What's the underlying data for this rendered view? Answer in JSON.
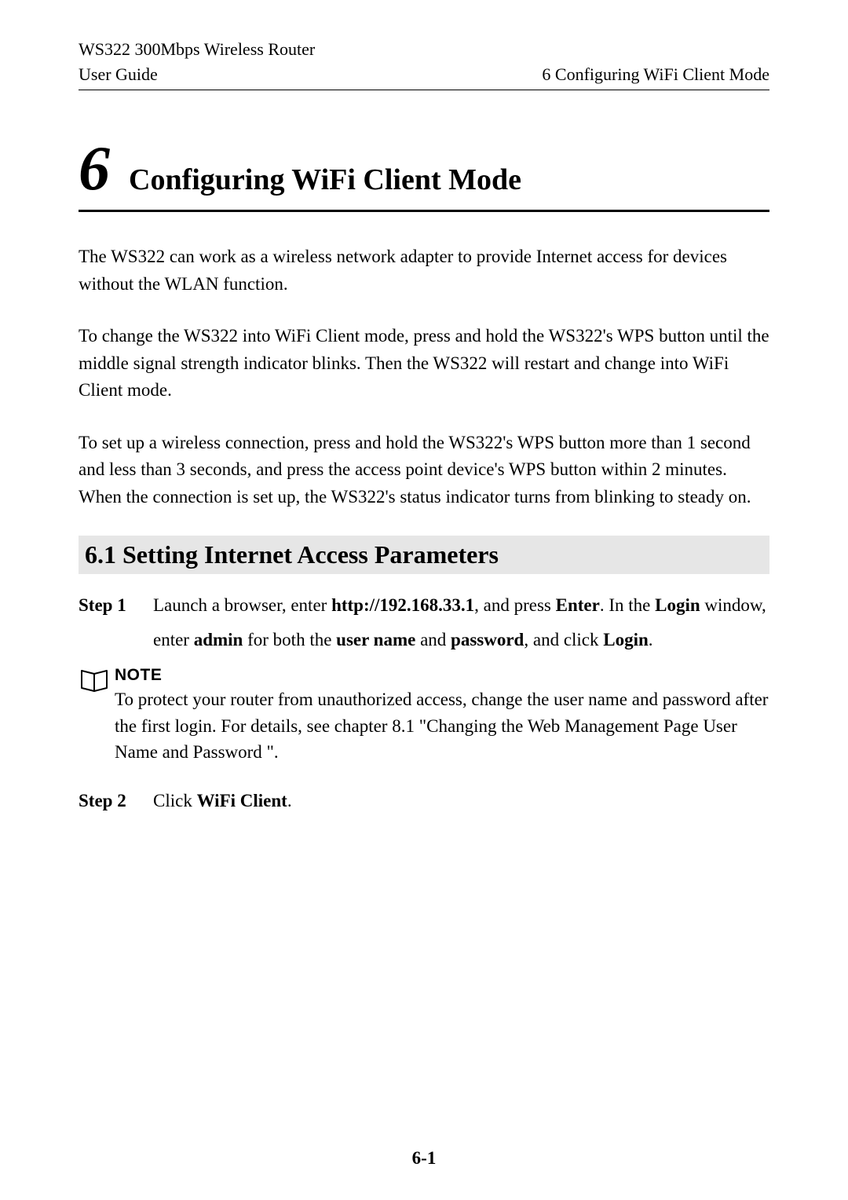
{
  "header": {
    "product": "WS322 300Mbps Wireless Router",
    "left": "User Guide",
    "right": "6 Configuring WiFi Client Mode"
  },
  "chapter": {
    "number": "6",
    "title": "Configuring WiFi Client Mode"
  },
  "paragraphs": {
    "p1": "The WS322 can work as a wireless network adapter to provide Internet access for devices without the WLAN function.",
    "p2": "To change the WS322 into WiFi Client mode, press and hold the WS322's WPS button until the middle signal strength indicator blinks. Then the WS322 will restart and change into WiFi Client mode.",
    "p3": "To set up a wireless connection, press and hold the WS322's WPS button more than 1 second and less than 3 seconds, and press the access point device's WPS button within 2 minutes. When the connection is set up, the WS322's status indicator turns from blinking to steady on."
  },
  "section_6_1": {
    "heading": "6.1 Setting Internet Access Parameters"
  },
  "step1": {
    "label": "Step 1",
    "seg1": "Launch a browser, enter ",
    "url": "http://192.168.33.1",
    "seg2": ", and press ",
    "enter": "Enter",
    "seg3": ". In the ",
    "login1": "Login",
    "seg4": " window, enter ",
    "admin": "admin",
    "seg5": " for both the ",
    "username": "user name",
    "seg6": " and ",
    "password": "password",
    "seg7": ", and click ",
    "login2": "Login",
    "seg8": "."
  },
  "note": {
    "label": "NOTE",
    "text": "To protect your router from unauthorized access, change the user name and password after the first login. For details, see chapter 8.1  \"Changing the Web Management Page User Name and Password \"."
  },
  "step2": {
    "label": "Step 2",
    "seg1": "Click ",
    "wifi_client": "WiFi Client",
    "seg2": "."
  },
  "page_number": "6-1"
}
